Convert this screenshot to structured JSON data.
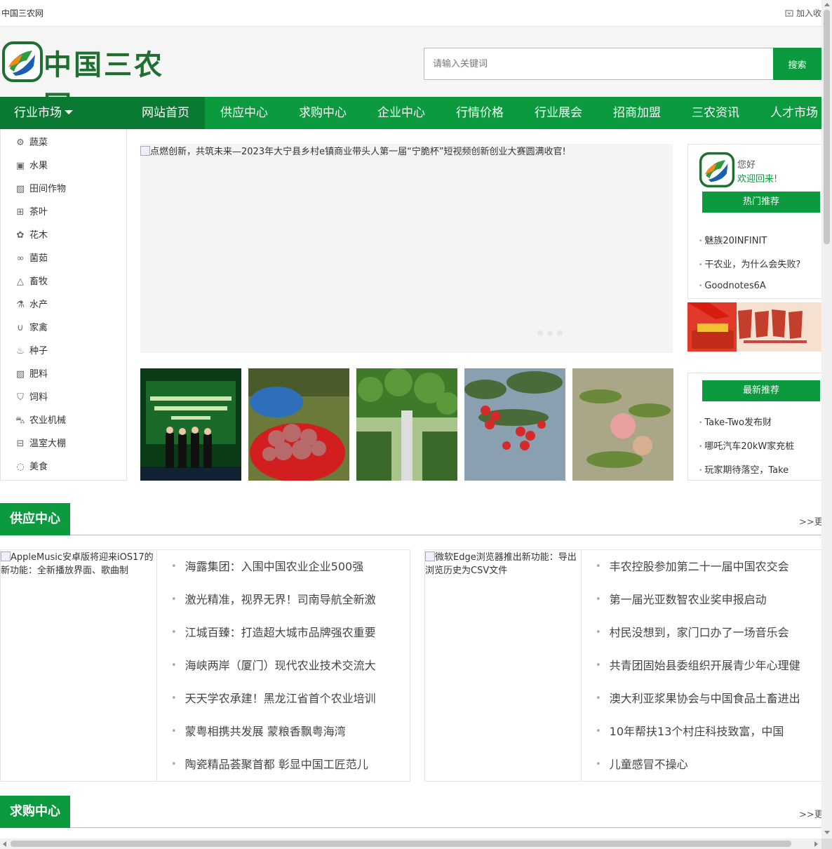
{
  "topbar": {
    "site_name": "中国三农网",
    "favorite": "加入收"
  },
  "header": {
    "logo_text": "中国三农网",
    "search": {
      "placeholder": "请输入关键词",
      "value": "",
      "button": "搜索"
    }
  },
  "nav": {
    "market": "行业市场",
    "items": [
      {
        "label": "网站首页",
        "active": true
      },
      {
        "label": "供应中心"
      },
      {
        "label": "求购中心"
      },
      {
        "label": "企业中心"
      },
      {
        "label": "行情价格"
      },
      {
        "label": "行业展会"
      },
      {
        "label": "招商加盟"
      },
      {
        "label": "三农资讯"
      },
      {
        "label": "人才市场"
      }
    ]
  },
  "categories": [
    {
      "label": "蔬菜",
      "icon": "gear-icon"
    },
    {
      "label": "水果",
      "icon": "box-icon"
    },
    {
      "label": "田间作物",
      "icon": "image-icon"
    },
    {
      "label": "茶叶",
      "icon": "grid-icon"
    },
    {
      "label": "花木",
      "icon": "flower-icon"
    },
    {
      "label": "菌茹",
      "icon": "link-icon"
    },
    {
      "label": "畜牧",
      "icon": "flask-icon"
    },
    {
      "label": "水产",
      "icon": "beaker-icon"
    },
    {
      "label": "家禽",
      "icon": "magnet-icon"
    },
    {
      "label": "种子",
      "icon": "seed-icon"
    },
    {
      "label": "肥料",
      "icon": "image-icon"
    },
    {
      "label": "饲料",
      "icon": "shield-icon"
    },
    {
      "label": "农业机械",
      "icon": "car-icon"
    },
    {
      "label": "温室大棚",
      "icon": "gift-icon"
    },
    {
      "label": "美食",
      "icon": "chat-icon"
    }
  ],
  "banner": {
    "alt": "点燃创新，共筑未来—2023年大宁县乡村e镇商业带头人第一届“宁脆杯”短视频创新创业大赛圆满收官!"
  },
  "welcome": {
    "hello": "您好",
    "welcome_back": "欢迎回来!",
    "hot_title": "热门推荐",
    "hot_items": [
      "魅族20INFINIT",
      "干农业，为什么会失败?",
      "Goodnotes6A"
    ]
  },
  "latest": {
    "title": "最新推荐",
    "items": [
      "Take-Two发布财",
      "哪吒汽车20kW家充桩",
      "玩家期待落空，Take"
    ]
  },
  "supply": {
    "label": "供应中心",
    "more": ">>更多",
    "left": {
      "pic_alt": "AppleMusic安卓版将迎来iOS17的新功能：全新播放界面、歌曲制",
      "items": [
        "海露集团：入围中国农业企业500强",
        "激光精准，视界无界！司南导航全新激",
        "江城百臻：打造超大城市品牌强农重要",
        "海峡两岸（厦门）现代农业技术交流大",
        "天天学农承建！黑龙江省首个农业培训",
        "蒙粤相携共发展 蒙粮香飘粤海湾",
        "陶瓷精品荟聚首都 彰显中国工匠范儿"
      ]
    },
    "right": {
      "pic_alt": "微软Edge浏览器推出新功能：导出浏览历史为CSV文件",
      "items": [
        "丰农控股参加第二十一届中国农交会",
        "第一届光亚数智农业奖申报启动",
        "村民没想到，家门口办了一场音乐会",
        "共青团固始县委组织开展青少年心理健",
        "澳大利亚浆果协会与中国食品土畜进出",
        "10年帮扶13个村庄科技致富，中国",
        "儿童感冒不操心"
      ]
    }
  },
  "purchase": {
    "label": "求购中心",
    "more": ">>更多"
  },
  "colors": {
    "brand_green": "#0c9a3f",
    "dark_green": "#0a7a32"
  }
}
